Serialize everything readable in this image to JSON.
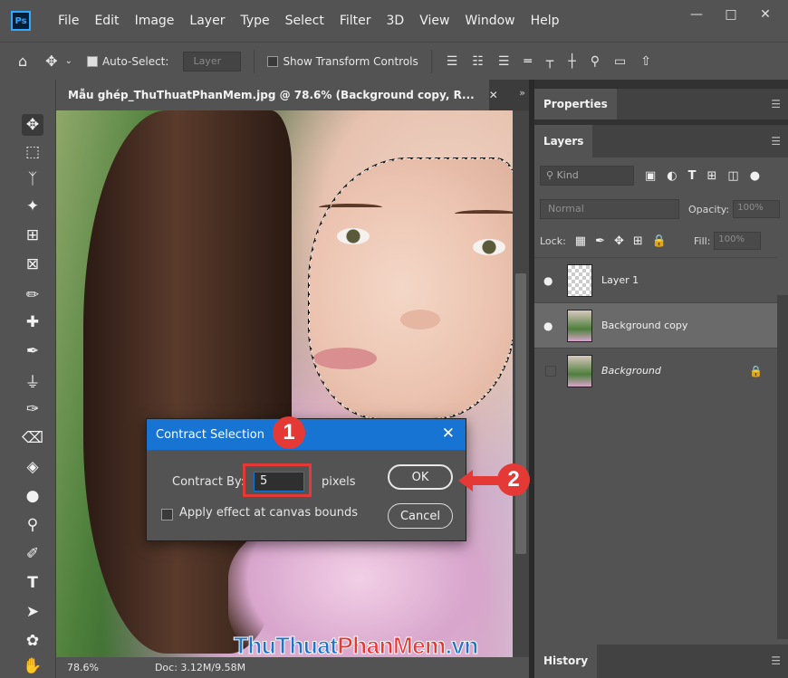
{
  "app": {
    "logo": "Ps"
  },
  "menu": [
    "File",
    "Edit",
    "Image",
    "Layer",
    "Type",
    "Select",
    "Filter",
    "3D",
    "View",
    "Window",
    "Help"
  ],
  "window_controls": [
    "minimize-icon",
    "maximize-icon",
    "close-icon"
  ],
  "options_bar": {
    "auto_select_label": "Auto-Select:",
    "auto_select_checked": true,
    "auto_select_target": "Layer",
    "show_transform_label": "Show Transform Controls",
    "show_transform_checked": false
  },
  "document": {
    "tab_title": "Mẫu ghép_ThuThuatPhanMem.jpg @ 78.6% (Background copy, R...",
    "zoom": "78.6%",
    "doc_size": "Doc: 3.12M/9.58M"
  },
  "panels": {
    "properties_tab": "Properties",
    "layers_tab": "Layers",
    "history_tab": "History",
    "kind_placeholder": "Kind",
    "blend_mode": "Normal",
    "opacity_label": "Opacity:",
    "opacity_value": "100%",
    "lock_label": "Lock:",
    "fill_label": "Fill:",
    "fill_value": "100%",
    "layers": [
      {
        "name": "Layer 1",
        "visible": true,
        "selected": false,
        "italic": false,
        "locked": false
      },
      {
        "name": "Background copy",
        "visible": true,
        "selected": true,
        "italic": false,
        "locked": false
      },
      {
        "name": "Background",
        "visible": false,
        "selected": false,
        "italic": true,
        "locked": true
      }
    ]
  },
  "dialog": {
    "title": "Contract Selection",
    "contract_by_label": "Contract By:",
    "contract_by_value": "5",
    "unit_label": "pixels",
    "apply_bounds_label": "Apply effect at canvas bounds",
    "apply_bounds_checked": false,
    "ok_label": "OK",
    "cancel_label": "Cancel"
  },
  "annotations": {
    "step_1": "1",
    "step_2": "2",
    "highlight_color": "#e53935"
  },
  "watermark": {
    "part1": "ThuThuat",
    "part2": "PhanMem",
    "part3": ".vn"
  },
  "colors": {
    "accent": "#1874d2",
    "panel": "#535353",
    "dark": "#323232"
  }
}
